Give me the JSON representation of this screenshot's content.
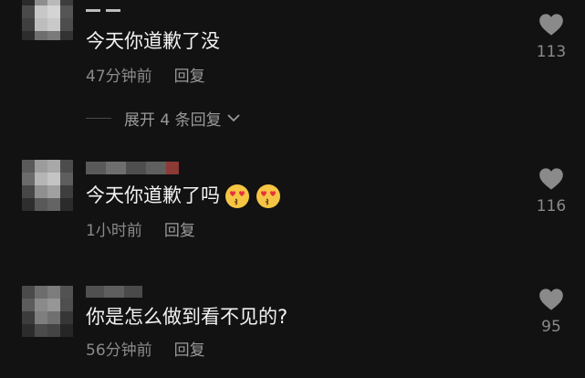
{
  "comments": [
    {
      "text": "今天你道歉了没",
      "time": "47分钟前",
      "reply_label": "回复",
      "likes": "113",
      "expand_replies": "展开 4 条回复"
    },
    {
      "text": "今天你道歉了吗",
      "emojis": [
        "heart-eyes-kiss-emoji",
        "heart-eyes-kiss-emoji"
      ],
      "time": "1小时前",
      "reply_label": "回复",
      "likes": "116"
    },
    {
      "text": "你是怎么做到看不见的?",
      "time": "56分钟前",
      "reply_label": "回复",
      "likes": "95"
    }
  ],
  "icons": {
    "like": "heart-icon",
    "expand": "chevron-down-icon"
  },
  "colors": {
    "background": "#121212",
    "text_primary": "#f2f2f2",
    "text_secondary": "#8a8a8a",
    "like_icon": "#8a8a8a"
  }
}
